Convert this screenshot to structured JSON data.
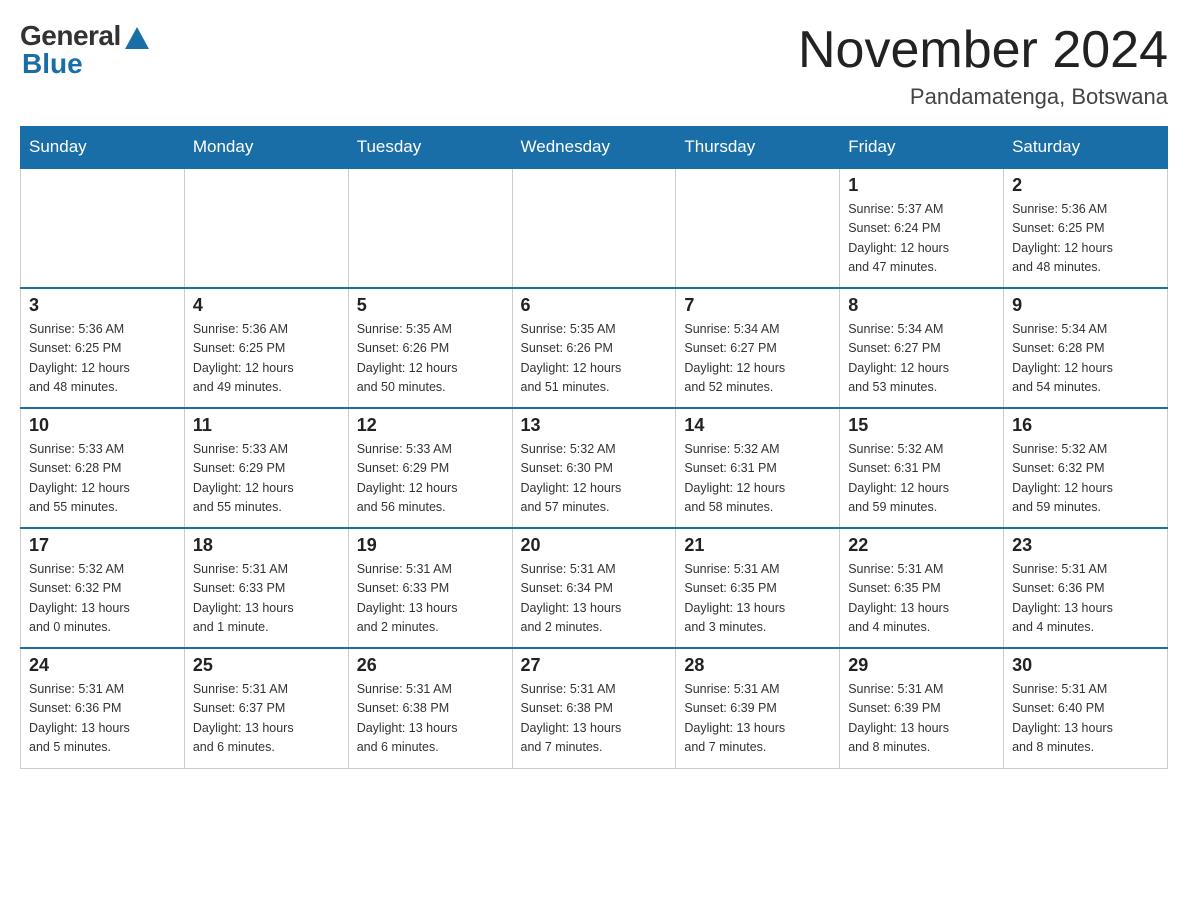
{
  "header": {
    "logo_general": "General",
    "logo_blue": "Blue",
    "month_title": "November 2024",
    "location": "Pandamatenga, Botswana"
  },
  "days_of_week": [
    "Sunday",
    "Monday",
    "Tuesday",
    "Wednesday",
    "Thursday",
    "Friday",
    "Saturday"
  ],
  "weeks": [
    [
      {
        "day": "",
        "info": ""
      },
      {
        "day": "",
        "info": ""
      },
      {
        "day": "",
        "info": ""
      },
      {
        "day": "",
        "info": ""
      },
      {
        "day": "",
        "info": ""
      },
      {
        "day": "1",
        "info": "Sunrise: 5:37 AM\nSunset: 6:24 PM\nDaylight: 12 hours\nand 47 minutes."
      },
      {
        "day": "2",
        "info": "Sunrise: 5:36 AM\nSunset: 6:25 PM\nDaylight: 12 hours\nand 48 minutes."
      }
    ],
    [
      {
        "day": "3",
        "info": "Sunrise: 5:36 AM\nSunset: 6:25 PM\nDaylight: 12 hours\nand 48 minutes."
      },
      {
        "day": "4",
        "info": "Sunrise: 5:36 AM\nSunset: 6:25 PM\nDaylight: 12 hours\nand 49 minutes."
      },
      {
        "day": "5",
        "info": "Sunrise: 5:35 AM\nSunset: 6:26 PM\nDaylight: 12 hours\nand 50 minutes."
      },
      {
        "day": "6",
        "info": "Sunrise: 5:35 AM\nSunset: 6:26 PM\nDaylight: 12 hours\nand 51 minutes."
      },
      {
        "day": "7",
        "info": "Sunrise: 5:34 AM\nSunset: 6:27 PM\nDaylight: 12 hours\nand 52 minutes."
      },
      {
        "day": "8",
        "info": "Sunrise: 5:34 AM\nSunset: 6:27 PM\nDaylight: 12 hours\nand 53 minutes."
      },
      {
        "day": "9",
        "info": "Sunrise: 5:34 AM\nSunset: 6:28 PM\nDaylight: 12 hours\nand 54 minutes."
      }
    ],
    [
      {
        "day": "10",
        "info": "Sunrise: 5:33 AM\nSunset: 6:28 PM\nDaylight: 12 hours\nand 55 minutes."
      },
      {
        "day": "11",
        "info": "Sunrise: 5:33 AM\nSunset: 6:29 PM\nDaylight: 12 hours\nand 55 minutes."
      },
      {
        "day": "12",
        "info": "Sunrise: 5:33 AM\nSunset: 6:29 PM\nDaylight: 12 hours\nand 56 minutes."
      },
      {
        "day": "13",
        "info": "Sunrise: 5:32 AM\nSunset: 6:30 PM\nDaylight: 12 hours\nand 57 minutes."
      },
      {
        "day": "14",
        "info": "Sunrise: 5:32 AM\nSunset: 6:31 PM\nDaylight: 12 hours\nand 58 minutes."
      },
      {
        "day": "15",
        "info": "Sunrise: 5:32 AM\nSunset: 6:31 PM\nDaylight: 12 hours\nand 59 minutes."
      },
      {
        "day": "16",
        "info": "Sunrise: 5:32 AM\nSunset: 6:32 PM\nDaylight: 12 hours\nand 59 minutes."
      }
    ],
    [
      {
        "day": "17",
        "info": "Sunrise: 5:32 AM\nSunset: 6:32 PM\nDaylight: 13 hours\nand 0 minutes."
      },
      {
        "day": "18",
        "info": "Sunrise: 5:31 AM\nSunset: 6:33 PM\nDaylight: 13 hours\nand 1 minute."
      },
      {
        "day": "19",
        "info": "Sunrise: 5:31 AM\nSunset: 6:33 PM\nDaylight: 13 hours\nand 2 minutes."
      },
      {
        "day": "20",
        "info": "Sunrise: 5:31 AM\nSunset: 6:34 PM\nDaylight: 13 hours\nand 2 minutes."
      },
      {
        "day": "21",
        "info": "Sunrise: 5:31 AM\nSunset: 6:35 PM\nDaylight: 13 hours\nand 3 minutes."
      },
      {
        "day": "22",
        "info": "Sunrise: 5:31 AM\nSunset: 6:35 PM\nDaylight: 13 hours\nand 4 minutes."
      },
      {
        "day": "23",
        "info": "Sunrise: 5:31 AM\nSunset: 6:36 PM\nDaylight: 13 hours\nand 4 minutes."
      }
    ],
    [
      {
        "day": "24",
        "info": "Sunrise: 5:31 AM\nSunset: 6:36 PM\nDaylight: 13 hours\nand 5 minutes."
      },
      {
        "day": "25",
        "info": "Sunrise: 5:31 AM\nSunset: 6:37 PM\nDaylight: 13 hours\nand 6 minutes."
      },
      {
        "day": "26",
        "info": "Sunrise: 5:31 AM\nSunset: 6:38 PM\nDaylight: 13 hours\nand 6 minutes."
      },
      {
        "day": "27",
        "info": "Sunrise: 5:31 AM\nSunset: 6:38 PM\nDaylight: 13 hours\nand 7 minutes."
      },
      {
        "day": "28",
        "info": "Sunrise: 5:31 AM\nSunset: 6:39 PM\nDaylight: 13 hours\nand 7 minutes."
      },
      {
        "day": "29",
        "info": "Sunrise: 5:31 AM\nSunset: 6:39 PM\nDaylight: 13 hours\nand 8 minutes."
      },
      {
        "day": "30",
        "info": "Sunrise: 5:31 AM\nSunset: 6:40 PM\nDaylight: 13 hours\nand 8 minutes."
      }
    ]
  ]
}
